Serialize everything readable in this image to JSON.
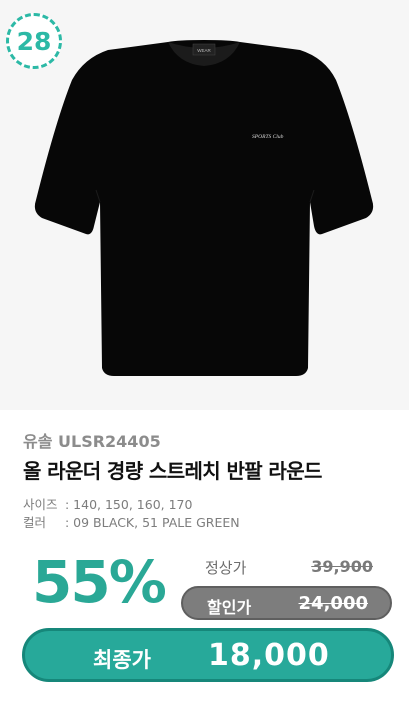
{
  "rank": "28",
  "product": {
    "image_alt": "black short-sleeve t-shirt",
    "chest_logo": "SPORTS Club",
    "neck_label": "WEAR",
    "brand_line": "유솔 ULSR24405",
    "title": "올 라운더 경량 스트레치 반팔 라운드",
    "size_label": "사이즈",
    "sizes": "140, 150, 160, 170",
    "color_label": "컬러",
    "colors": "09 BLACK, 51 PALE GREEN"
  },
  "pricing": {
    "discount_rate": "55%",
    "regular_label": "정상가",
    "regular_price": "39,900",
    "sale_label": "할인가",
    "sale_price": "24,000",
    "final_label": "최종가",
    "final_price": "18,000"
  },
  "colors": {
    "accent": "#2cb9a6",
    "final_bar": "#27a99a",
    "sale_pill": "#7d7d7d",
    "photo_bg": "#f6f6f6"
  }
}
